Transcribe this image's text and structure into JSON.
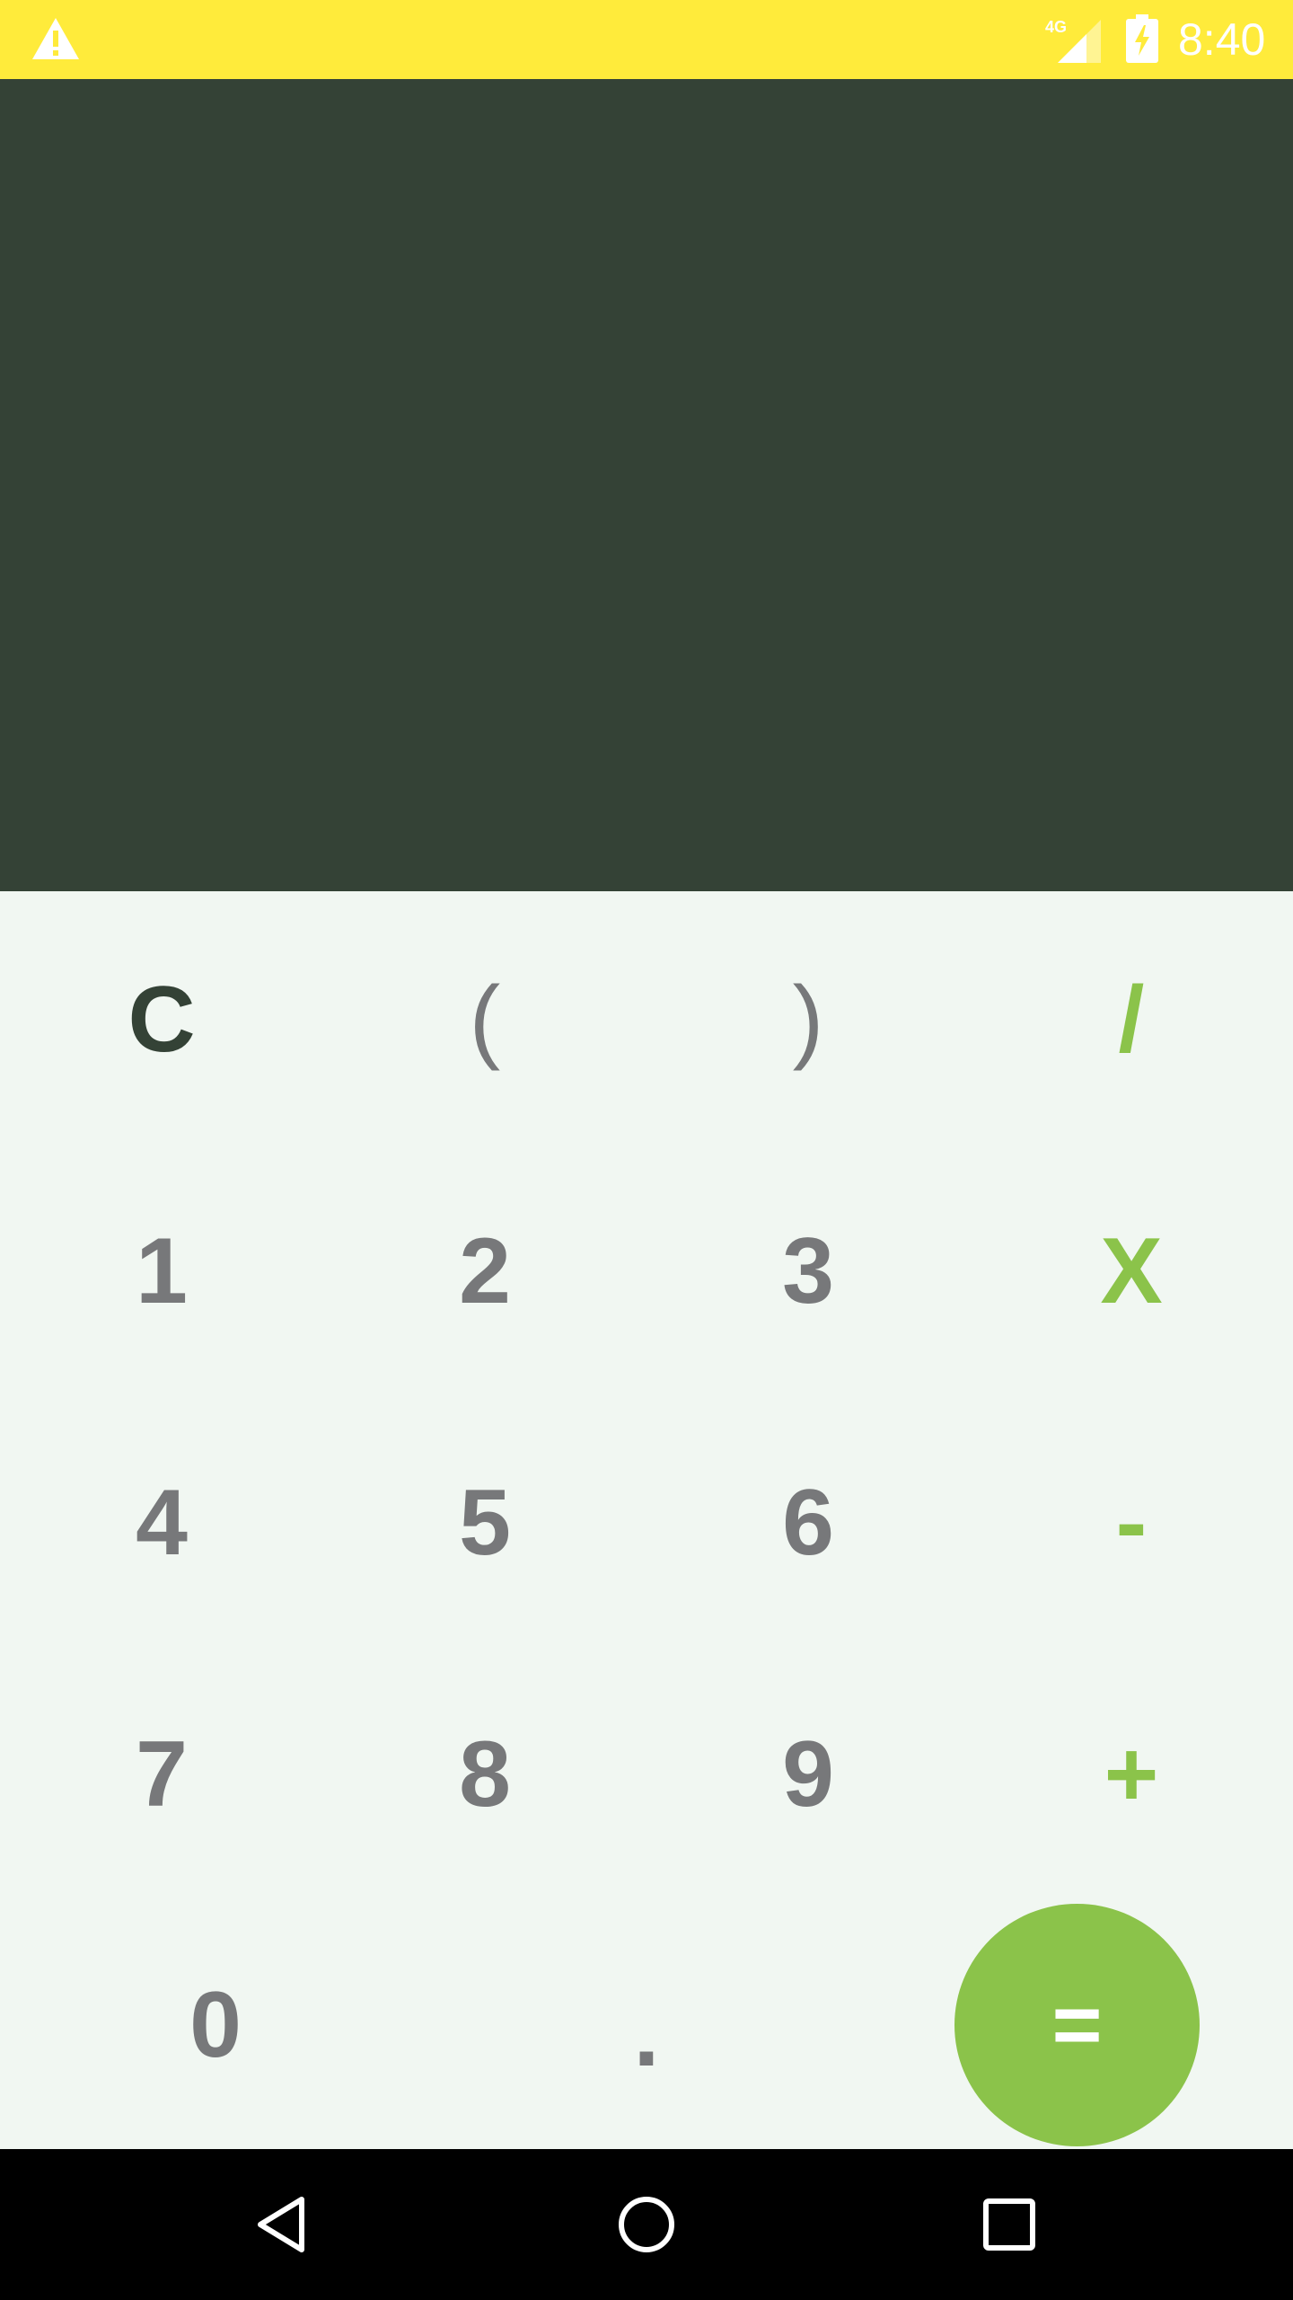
{
  "status_bar": {
    "time": "8:40",
    "network_label": "4G",
    "icons": [
      "warning-icon",
      "signal-icon",
      "battery-charging-icon"
    ],
    "background_color": "#ffeb3b"
  },
  "display": {
    "expression": "",
    "background_color": "#344236"
  },
  "keypad": {
    "row1": {
      "clear": "C",
      "open_paren": "(",
      "close_paren": ")",
      "divide": "/"
    },
    "row2": {
      "one": "1",
      "two": "2",
      "three": "3",
      "multiply": "X"
    },
    "row3": {
      "four": "4",
      "five": "5",
      "six": "6",
      "minus": "-"
    },
    "row4": {
      "seven": "7",
      "eight": "8",
      "nine": "9",
      "plus": "+"
    },
    "row5": {
      "zero": "0",
      "decimal": ".",
      "equals": "="
    },
    "colors": {
      "background": "#f1f7f2",
      "digit": "#77787a",
      "operator": "#8bc34a",
      "clear": "#344236",
      "equals_fill": "#8bc34a"
    }
  },
  "nav_bar": {
    "icons": [
      "back-icon",
      "home-icon",
      "recents-icon"
    ]
  }
}
